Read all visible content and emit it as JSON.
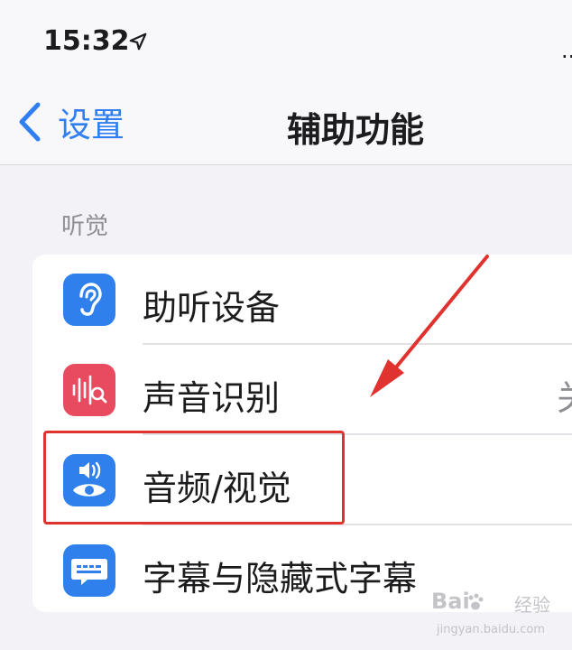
{
  "status_bar": {
    "time": "15:32",
    "signal_dots": ".."
  },
  "nav": {
    "back_label": "设置",
    "title": "辅助功能"
  },
  "section": {
    "header": "听觉"
  },
  "rows": [
    {
      "label": "助听设备",
      "value": "",
      "icon": "ear-icon",
      "icon_color": "#2f80ed"
    },
    {
      "label": "声音识别",
      "value": "关",
      "icon": "sound-recognition-icon",
      "icon_color": "#e84a5f"
    },
    {
      "label": "音频/视觉",
      "value": "",
      "icon": "audio-visual-icon",
      "icon_color": "#2f80ed"
    },
    {
      "label": "字幕与隐藏式字幕",
      "value": "",
      "icon": "subtitles-icon",
      "icon_color": "#2f80ed"
    }
  ],
  "annotation": {
    "highlight_color": "#e0322e",
    "arrow_color": "#e0322e"
  },
  "watermark": {
    "brand": "Bai",
    "brand_cn": "经验",
    "url": "jingyan.baidu.com"
  }
}
